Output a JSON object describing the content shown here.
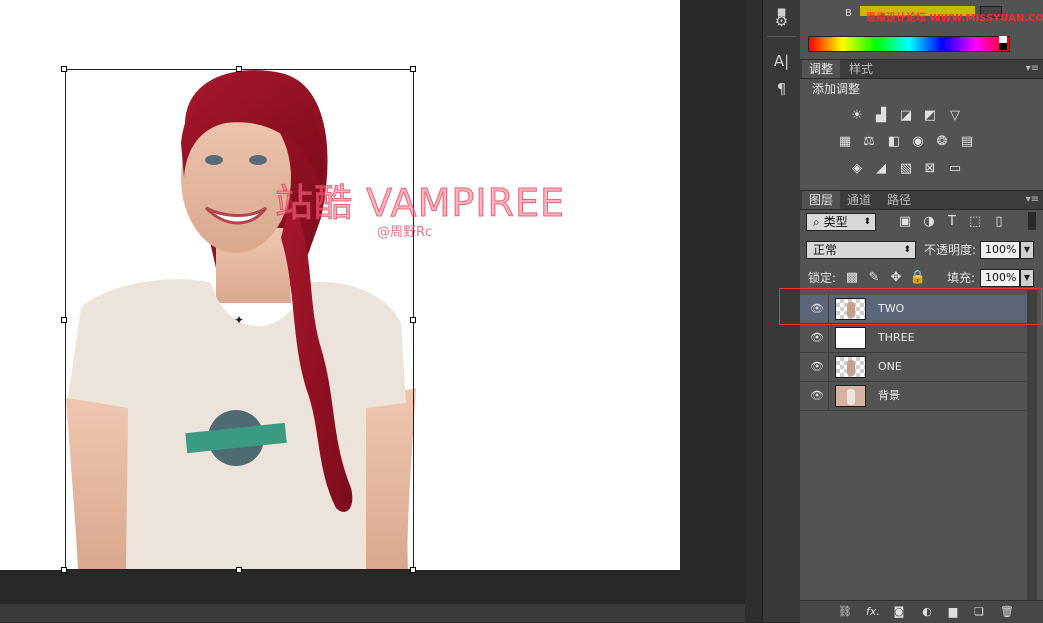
{
  "color_panel": {
    "channel_label": "B"
  },
  "brand_watermark": {
    "text": "思缘设计论坛 WWW.MISSYUAN.COM"
  },
  "canvas": {
    "watermark_title": "站酷 VAMPIREE",
    "watermark_author": "@周野Rc"
  },
  "tools": [
    "A|",
    "¶"
  ],
  "adjustments": {
    "tabs": [
      "调整",
      "样式"
    ],
    "heading": "添加调整",
    "row1": [
      "brightness-icon",
      "levels-icon",
      "curves-icon",
      "exposure-icon",
      "vibrance-icon"
    ],
    "row2": [
      "hue-saturation-icon",
      "color-balance-icon",
      "black-white-icon",
      "photo-filter-icon",
      "channel-mixer-icon",
      "color-lookup-icon"
    ],
    "row3": [
      "invert-icon",
      "posterize-icon",
      "threshold-icon",
      "selective-color-icon",
      "gradient-map-icon"
    ]
  },
  "layers": {
    "tabs": [
      "图层",
      "通道",
      "路径"
    ],
    "filter_kind": "类型",
    "blend_mode": "正常",
    "opacity_label": "不透明度:",
    "opacity_value": "100%",
    "lock_label": "锁定:",
    "fill_label": "填充:",
    "fill_value": "100%",
    "items": [
      {
        "name": "TWO",
        "selected": true
      },
      {
        "name": "THREE",
        "selected": false
      },
      {
        "name": "ONE",
        "selected": false
      },
      {
        "name": "背景",
        "selected": false
      }
    ]
  },
  "colors": {
    "selected_row": "#5a6577",
    "highlight_border": "#e23a3a",
    "panel_bg": "#535353"
  }
}
